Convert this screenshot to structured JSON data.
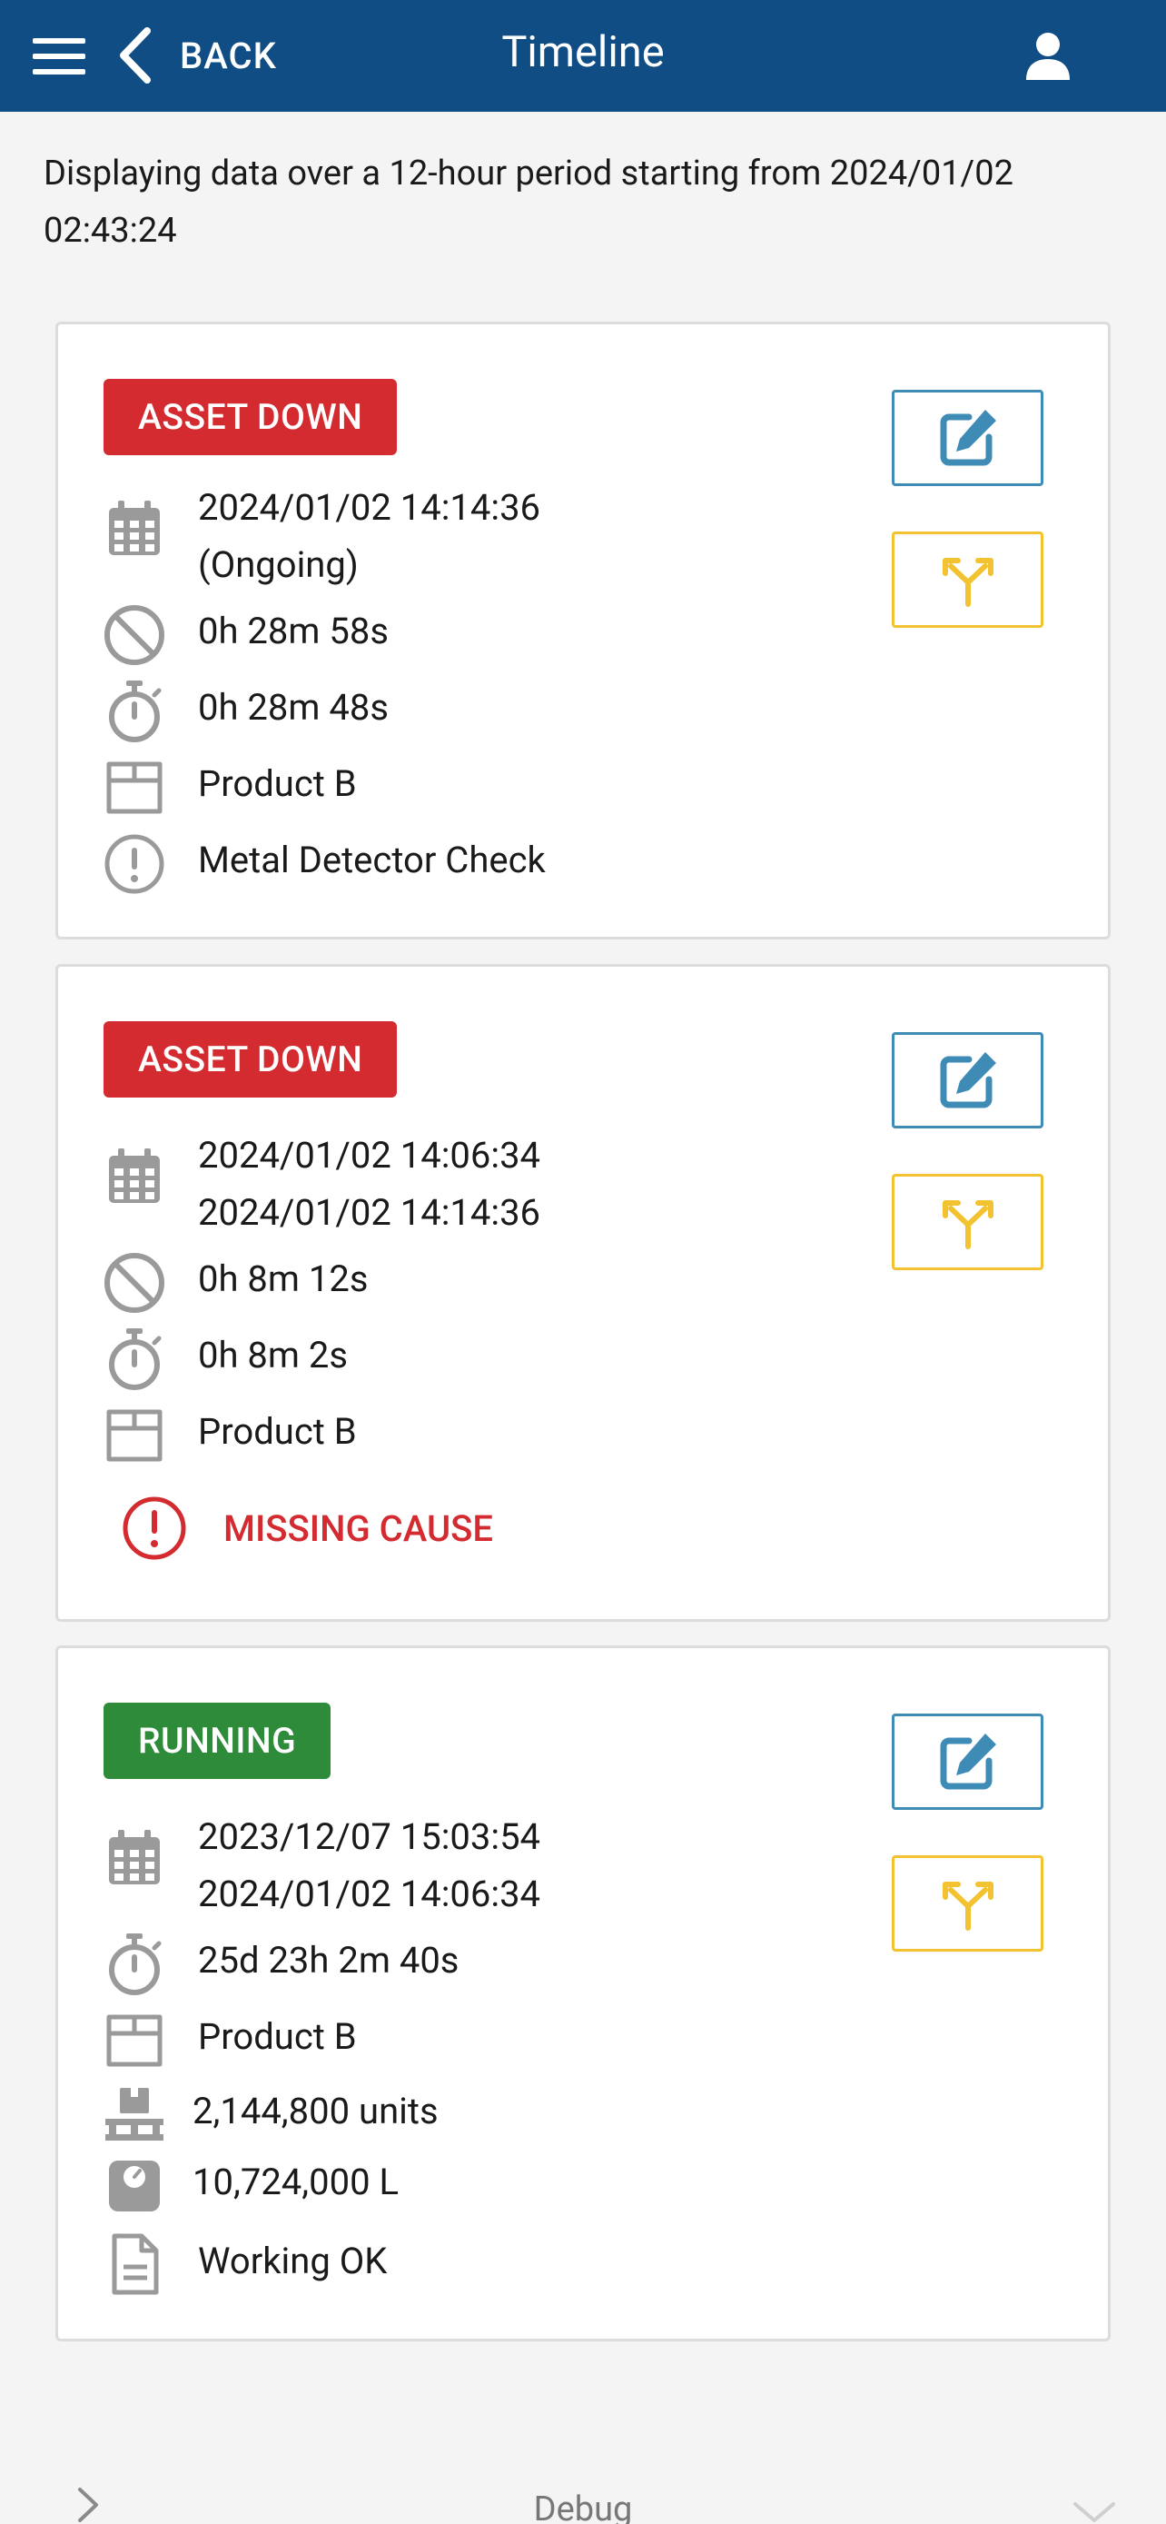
{
  "header": {
    "back_label": "BACK",
    "title": "Timeline"
  },
  "intro": "Displaying data over a 12-hour period starting from 2024/01/02 02:43:24",
  "colors": {
    "header_bg": "#0f4d84",
    "asset_down": "#d32b2f",
    "running": "#2e8b3a",
    "edit_border": "#3e8bb6",
    "split_border": "#f2c230",
    "icon_gray": "#9a9a9a"
  },
  "icons": {
    "date": "calendar-icon",
    "downtime": "no-entry-icon",
    "duration": "stopwatch-icon",
    "product": "box-icon",
    "cause": "alert-circle-icon",
    "units": "pallet-icon",
    "volume": "scale-icon",
    "note": "document-icon",
    "edit": "edit-icon",
    "split": "split-icon"
  },
  "cards": [
    {
      "status": "ASSET DOWN",
      "start": "2024/01/02 14:14:36",
      "end": "(Ongoing)",
      "downtime": "0h 28m 58s",
      "duration": "0h 28m 48s",
      "product": "Product B",
      "cause": "Metal Detector Check"
    },
    {
      "status": "ASSET DOWN",
      "start": "2024/01/02 14:06:34",
      "end": "2024/01/02 14:14:36",
      "downtime": "0h 8m 12s",
      "duration": "0h 8m 2s",
      "product": "Product B",
      "missing_cause": "MISSING CAUSE"
    },
    {
      "status": "RUNNING",
      "start": "2023/12/07 15:03:54",
      "end": "2024/01/02 14:06:34",
      "duration": "25d 23h 2m 40s",
      "product": "Product B",
      "units": "2,144,800 units",
      "volume": "10,724,000 L",
      "note": "Working OK"
    }
  ],
  "footer": {
    "debug_label": "Debug"
  }
}
